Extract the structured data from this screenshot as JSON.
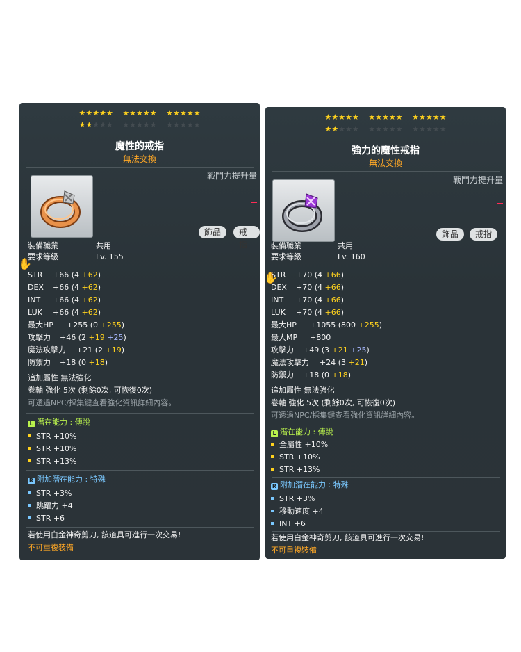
{
  "left": {
    "stars": {
      "row1": "★★★★★",
      "row2": "★★★★★",
      "row3": "★★★★★",
      "row4_on": "★★",
      "row4_off": "★★★",
      "row5": "★★★★★",
      "row6": "★★★★★"
    },
    "name": "魔性的戒指",
    "trade": "無法交換",
    "power_label": "戰鬥力提升量",
    "tags": [
      "飾品",
      "戒指"
    ],
    "job_label": "裝備職業",
    "job_value": "共用",
    "level_label": "要求等級",
    "level_value": "Lv. 155",
    "stats": [
      {
        "label": "STR",
        "base": "+66",
        "open": "(4",
        "bonus": "+62",
        "close": ")"
      },
      {
        "label": "DEX",
        "base": "+66",
        "open": "(4",
        "bonus": "+62",
        "close": ")"
      },
      {
        "label": "INT",
        "base": "+66",
        "open": "(4",
        "bonus": "+62",
        "close": ")"
      },
      {
        "label": "LUK",
        "base": "+66",
        "open": "(4",
        "bonus": "+62",
        "close": ")"
      }
    ],
    "hp": {
      "label": "最大HP",
      "base": "+255",
      "open": "(0",
      "bonus": "+255",
      "close": ")"
    },
    "atk": {
      "label": "攻擊力",
      "base": "+46",
      "open": "(2",
      "bonus": "+19",
      "extra": "+25",
      "close": ")"
    },
    "matk": {
      "label": "魔法攻擊力",
      "base": "+21",
      "open": "(2",
      "bonus": "+19",
      "close": ")"
    },
    "def": {
      "label": "防禦力",
      "base": "+18",
      "open": "(0",
      "bonus": "+18",
      "close": ")"
    },
    "extra_attr": "追加屬性  無法強化",
    "scroll": "卷軸  強化  5次  (剩餘0次, 可恢復0次)",
    "npc_hint": "可透過NPC/採集鍵查看強化資訊詳細內容。",
    "potential": {
      "icon": "L",
      "label": "潛在能力 : 傳說",
      "lines": [
        "STR  +10%",
        "STR  +10%",
        "STR  +13%"
      ]
    },
    "bonus_potential": {
      "icon": "R",
      "label": "附加潛在能力 : 特殊",
      "lines": [
        "STR  +3%",
        "跳躍力  +4",
        "STR  +6"
      ]
    },
    "scissors": "若使用白金神奇剪刀, 該道具可進行一次交易!",
    "no_dup": "不可重複裝備"
  },
  "right": {
    "stars": {
      "row1": "★★★★★",
      "row2": "★★★★★",
      "row3": "★★★★★",
      "row4_on": "★★",
      "row4_off": "★★★",
      "row5": "★★★★★",
      "row6": "★★★★★"
    },
    "name": "強力的魔性戒指",
    "trade": "無法交換",
    "power_label": "戰鬥力提升量",
    "tags": [
      "飾品",
      "戒指"
    ],
    "job_label": "裝備職業",
    "job_value": "共用",
    "level_label": "要求等級",
    "level_value": "Lv. 160",
    "stats": [
      {
        "label": "STR",
        "base": "+70",
        "open": "(4",
        "bonus": "+66",
        "close": ")"
      },
      {
        "label": "DEX",
        "base": "+70",
        "open": "(4",
        "bonus": "+66",
        "close": ")"
      },
      {
        "label": "INT",
        "base": "+70",
        "open": "(4",
        "bonus": "+66",
        "close": ")"
      },
      {
        "label": "LUK",
        "base": "+70",
        "open": "(4",
        "bonus": "+66",
        "close": ")"
      }
    ],
    "hp": {
      "label": "最大HP",
      "base": "+1055",
      "open": "(800",
      "bonus": "+255",
      "close": ")"
    },
    "mp": {
      "label": "最大MP",
      "base": "+800"
    },
    "atk": {
      "label": "攻擊力",
      "base": "+49",
      "open": "(3",
      "bonus": "+21",
      "extra": "+25",
      "close": ")"
    },
    "matk": {
      "label": "魔法攻擊力",
      "base": "+24",
      "open": "(3",
      "bonus": "+21",
      "close": ")"
    },
    "def": {
      "label": "防禦力",
      "base": "+18",
      "open": "(0",
      "bonus": "+18",
      "close": ")"
    },
    "extra_attr": "追加屬性  無法強化",
    "scroll": "卷軸  強化  5次  (剩餘0次, 可恢復0次)",
    "npc_hint": "可透過NPC/採集鍵查看強化資訊詳細內容。",
    "potential": {
      "icon": "L",
      "label": "潛在能力 : 傳說",
      "lines": [
        "全屬性  +10%",
        "STR  +10%",
        "STR  +13%"
      ]
    },
    "bonus_potential": {
      "icon": "R",
      "label": "附加潛在能力 : 特殊",
      "lines": [
        "STR  +3%",
        "移動速度  +4",
        "INT  +6"
      ]
    },
    "scissors": "若使用白金神奇剪刀, 該道具可進行一次交易!",
    "no_dup": "不可重複裝備"
  },
  "colors": {
    "bonus": "#ffd21e",
    "extra": "#a7b8ff",
    "trade": "#ffa826",
    "legend": "#b9f14d",
    "unique": "#7ac8ff"
  }
}
